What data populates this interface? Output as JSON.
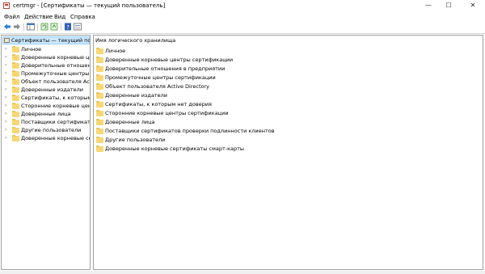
{
  "window": {
    "title": "certmgr - [Сертификаты — текущий пользователь]",
    "controls": {
      "minimize": "—",
      "maximize": "☐",
      "close": "✕"
    }
  },
  "menu": [
    "Файл",
    "Действие",
    "Вид",
    "Справка"
  ],
  "toolbar": {
    "icons": [
      "back-arrow-icon",
      "forward-arrow-icon",
      "show-console-tree-icon",
      "refresh-icon",
      "export-list-icon",
      "help-icon",
      "properties-icon"
    ]
  },
  "tree": {
    "root_label": "Сертификаты — текущий пользо",
    "items": [
      "Личное",
      "Доверенные корневые це",
      "Доверительные отношени",
      "Промежуточные центры се",
      "Объект пользователя Active",
      "Доверенные издатели",
      "Сертификаты, к которым не",
      "Сторонние корневые центр",
      "Доверенные лица",
      "Поставщики сертификатов",
      "Другие пользователи",
      "Доверенные корневые сертиф"
    ]
  },
  "list": {
    "column_header": "Имя логического хранилища",
    "items": [
      "Личное",
      "Доверенные корневые центры сертификации",
      "Доверительные отношения в предприятии",
      "Промежуточные центры сертификации",
      "Объект пользователя Active Directory",
      "Доверенные издатели",
      "Сертификаты, к которым нет доверия",
      "Сторонние корневые центры сертификации",
      "Доверенные лица",
      "Поставщики сертификатов проверки подлинности клиентов",
      "Другие пользователи",
      "Доверенные корневые сертификаты смарт-карты"
    ]
  },
  "colors": {
    "selection_bg": "#cce8ff",
    "folder": "#f7d774",
    "pane_border": "#a0a0a0"
  }
}
